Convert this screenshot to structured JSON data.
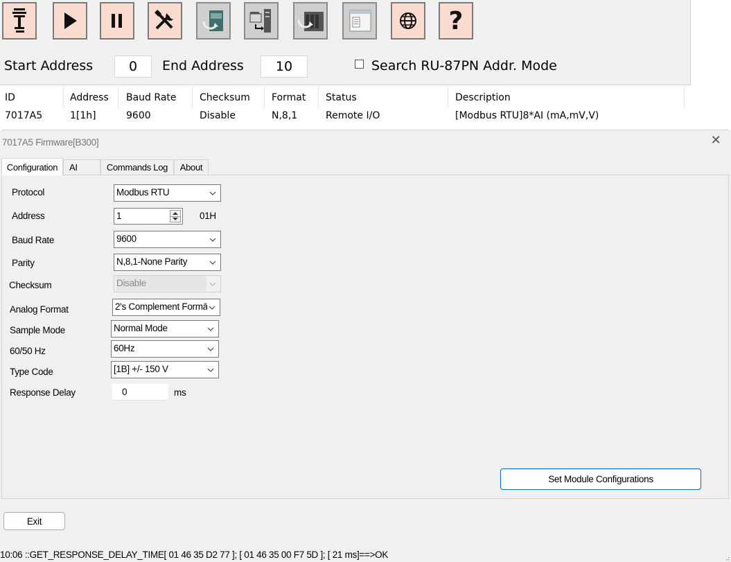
{
  "toolbar": {
    "buttons": [
      {
        "icon": "module-probe-icon"
      },
      {
        "icon": "play-icon"
      },
      {
        "icon": "pause-icon"
      },
      {
        "icon": "tools-icon"
      },
      {
        "icon": "module-firmware-icon"
      },
      {
        "icon": "module-swap-icon"
      },
      {
        "icon": "rack-update-icon"
      },
      {
        "icon": "window-config-icon"
      },
      {
        "icon": "globe-icon"
      },
      {
        "icon": "help-icon"
      }
    ]
  },
  "address": {
    "start_label": "Start Address",
    "start_value": "0",
    "end_label": "End Address",
    "end_value": "10",
    "search_label": "Search RU-87PN Addr. Mode",
    "search_checked": false
  },
  "module_list": {
    "columns": [
      "ID",
      "Address",
      "Baud Rate",
      "Checksum",
      "Format",
      "Status",
      "Description"
    ],
    "rows": [
      [
        "7017A5",
        "1[1h]",
        "9600",
        "Disable",
        "N,8,1",
        "Remote I/O",
        "[Modbus RTU]8*AI (mA,mV,V)"
      ]
    ]
  },
  "dialog": {
    "title": "7017A5 Firmware[B300]",
    "tabs": [
      {
        "label": "Configuration",
        "active": true
      },
      {
        "label": "AI",
        "active": false
      },
      {
        "label": "Commands Log",
        "active": false
      },
      {
        "label": "About",
        "active": false
      }
    ],
    "fields": {
      "protocol": {
        "label": "Protocol",
        "value": "Modbus RTU"
      },
      "address": {
        "label": "Address",
        "value": "1",
        "hex": "01H"
      },
      "baud_rate": {
        "label": "Baud Rate",
        "value": "9600"
      },
      "parity": {
        "label": "Parity",
        "value": "N,8,1-None Parity"
      },
      "checksum": {
        "label": "Checksum",
        "value": "Disable",
        "disabled": true
      },
      "analog_format": {
        "label": "Analog Format",
        "value": "2's Complement Formā"
      },
      "sample_mode": {
        "label": "Sample Mode",
        "value": "Normal Mode"
      },
      "frequency": {
        "label": "60/50 Hz",
        "value": "60Hz"
      },
      "type_code": {
        "label": "Type Code",
        "value": "[1B] +/- 150 V"
      },
      "response_delay": {
        "label": "Response Delay",
        "value": "0",
        "unit": "ms"
      }
    },
    "set_button": "Set Module Configurations",
    "exit_button": "Exit",
    "status": "10:06 ::GET_RESPONSE_DELAY_TIME[ 01 46 35 D2 77 ]; [ 01 46 35 00 F7 5D  ]; [ 21 ms]==>OK"
  }
}
